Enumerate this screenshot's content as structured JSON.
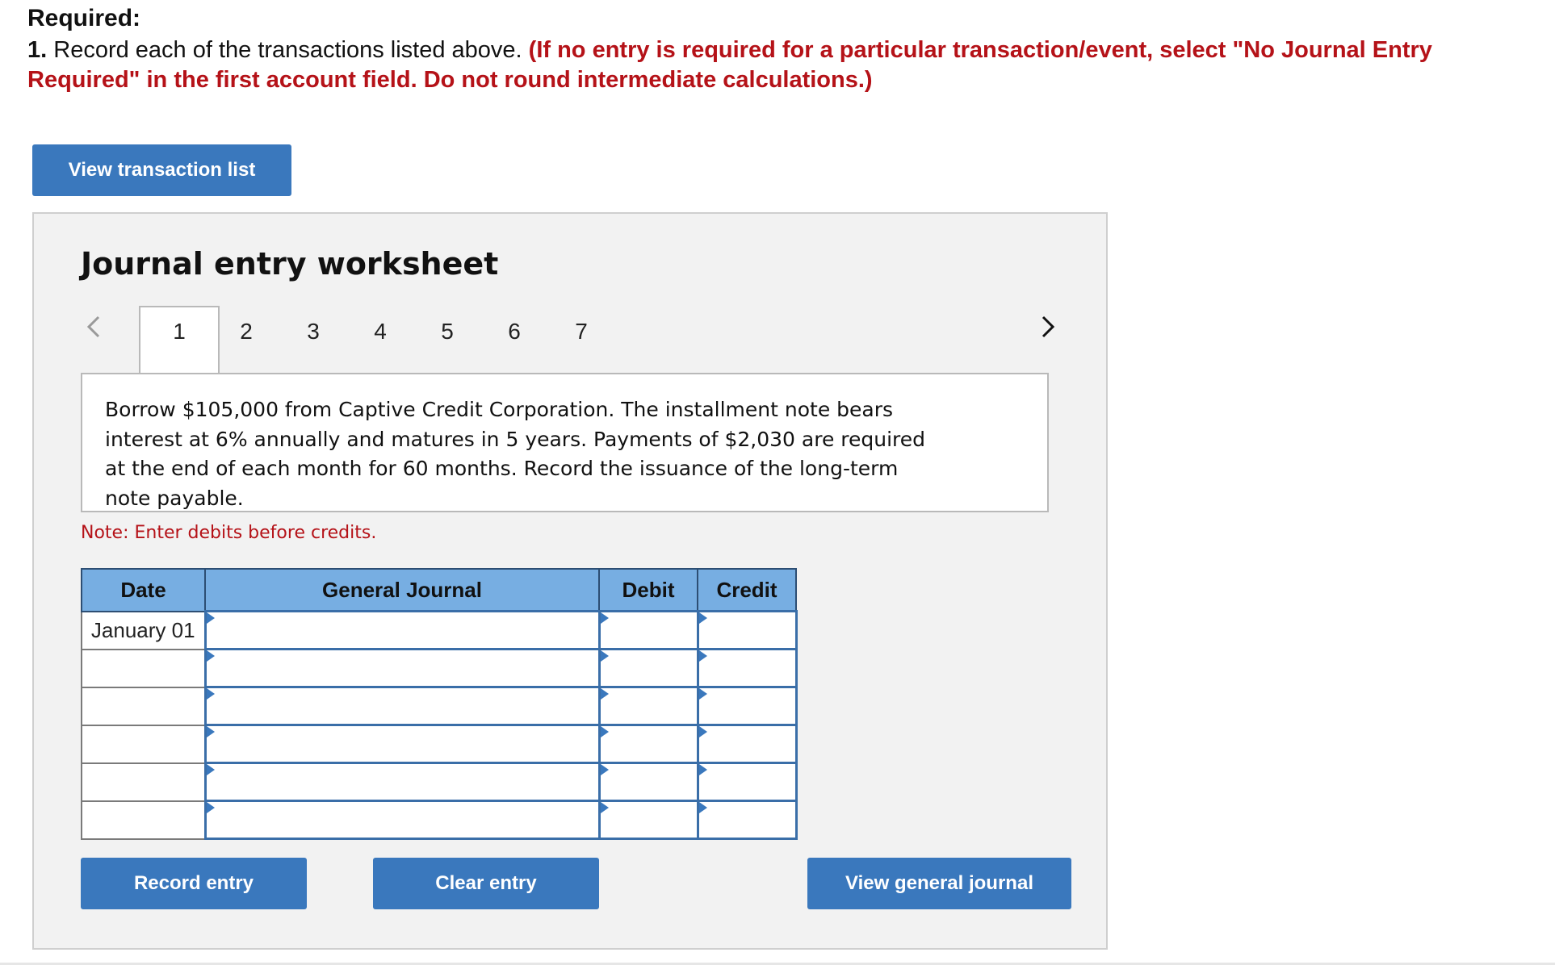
{
  "header": {
    "required_label": "Required:",
    "item_number": "1.",
    "instruction_text": " Record each of the transactions listed above. ",
    "instruction_note": "(If no entry is required for a particular transaction/event, select \"No Journal Entry Required\" in the first account field. Do not round intermediate calculations.)"
  },
  "view_transaction_list_label": "View transaction list",
  "worksheet": {
    "title": "Journal entry worksheet",
    "tabs": [
      "1",
      "2",
      "3",
      "4",
      "5",
      "6",
      "7"
    ],
    "active_tab": "1",
    "description": "Borrow $105,000 from Captive Credit Corporation. The installment note bears interest at 6% annually and matures in 5 years. Payments of $2,030 are required at the end of each month for 60 months. Record the issuance of the long-term note payable.",
    "note": "Note: Enter debits before credits.",
    "table": {
      "headers": {
        "date": "Date",
        "journal": "General Journal",
        "debit": "Debit",
        "credit": "Credit"
      },
      "rows": [
        {
          "date": "January 01",
          "account": "",
          "debit": "",
          "credit": ""
        },
        {
          "date": "",
          "account": "",
          "debit": "",
          "credit": ""
        },
        {
          "date": "",
          "account": "",
          "debit": "",
          "credit": ""
        },
        {
          "date": "",
          "account": "",
          "debit": "",
          "credit": ""
        },
        {
          "date": "",
          "account": "",
          "debit": "",
          "credit": ""
        },
        {
          "date": "",
          "account": "",
          "debit": "",
          "credit": ""
        }
      ]
    },
    "buttons": {
      "record": "Record entry",
      "clear": "Clear entry",
      "view_general": "View general journal"
    }
  },
  "icons": {
    "prev": "chevron-left-icon",
    "next": "chevron-right-icon"
  },
  "colors": {
    "accent": "#3a78bd",
    "header_fill": "#77aee2",
    "note_red": "#b51218",
    "panel_bg": "#f2f2f2"
  }
}
